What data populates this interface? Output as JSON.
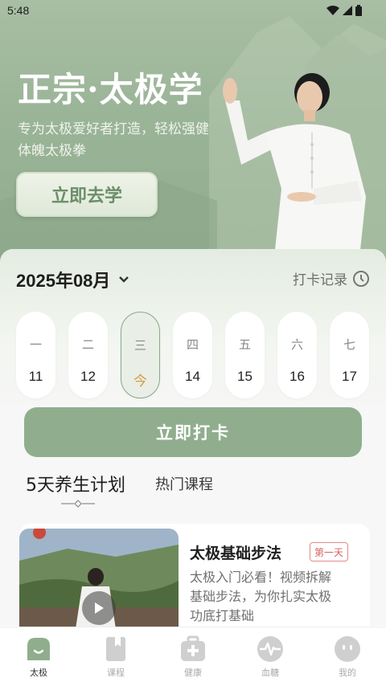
{
  "status": {
    "time": "5:48"
  },
  "hero": {
    "title": "正宗·太极学",
    "subtitle": "专为太极爱好者打造，轻松强健体魄太极拳",
    "cta": "立即去学"
  },
  "calendar": {
    "month": "2025年08月",
    "record_label": "打卡记录",
    "days": [
      {
        "weekday": "一",
        "date": "11"
      },
      {
        "weekday": "二",
        "date": "12"
      },
      {
        "weekday": "三",
        "date": "今"
      },
      {
        "weekday": "四",
        "date": "14"
      },
      {
        "weekday": "五",
        "date": "15"
      },
      {
        "weekday": "六",
        "date": "16"
      },
      {
        "weekday": "七",
        "date": "17"
      }
    ],
    "checkin_label": "立即打卡"
  },
  "tabs": {
    "active": "5天养生计划",
    "other": "热门课程"
  },
  "course": {
    "title": "太极基础步法",
    "badge": "第一天",
    "description": "太极入门必看！视频拆解基础步法，为你扎实太极功底打基础"
  },
  "nav": {
    "items": [
      {
        "label": "太极",
        "icon": "taiji-home-icon",
        "active": true
      },
      {
        "label": "课程",
        "icon": "bookmark-icon"
      },
      {
        "label": "健康",
        "icon": "medical-kit-icon"
      },
      {
        "label": "血糖",
        "icon": "pulse-icon"
      },
      {
        "label": "我的",
        "icon": "profile-face-icon"
      }
    ]
  },
  "colors": {
    "accent": "#90ae8d",
    "hero_bg": "#9ab497",
    "today_text": "#d39a3e",
    "badge_red": "#d9615e"
  }
}
